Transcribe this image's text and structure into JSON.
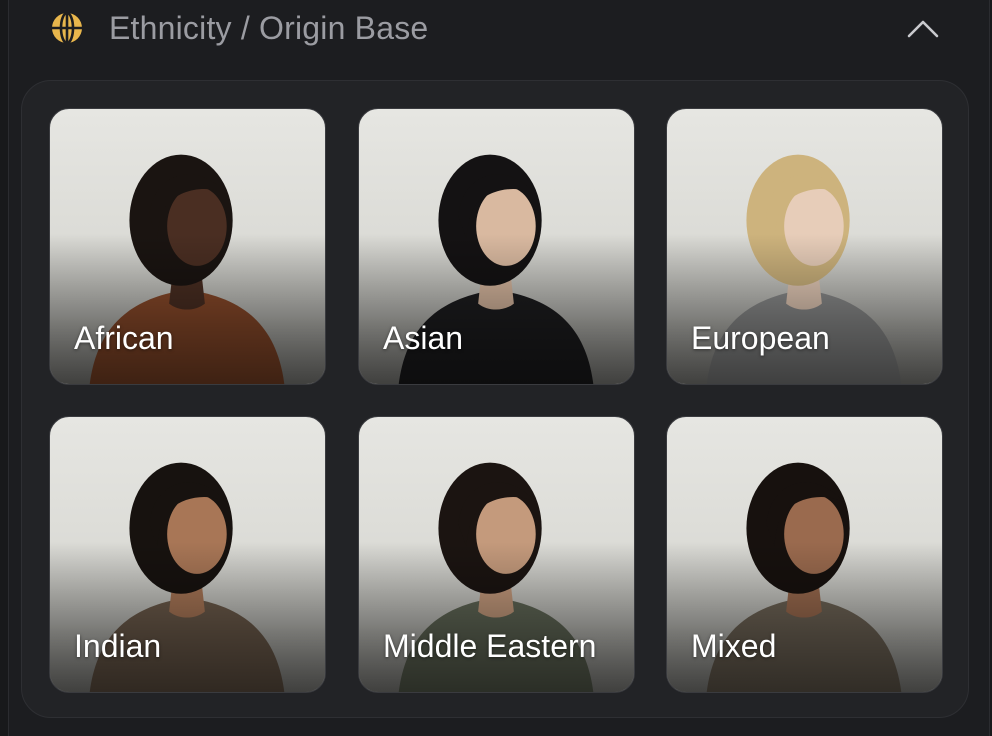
{
  "section": {
    "title": "Ethnicity / Origin Base",
    "icon": "globe-icon",
    "collapse_icon": "chevron-up-icon",
    "accent_color": "#e8b64c"
  },
  "options": [
    {
      "label": "African",
      "hair": "#1a1411",
      "skin": "#4a2e22",
      "top": "#8a4a2a"
    },
    {
      "label": "Asian",
      "hair": "#141213",
      "skin": "#d9b9a0",
      "top": "#1d1d1f"
    },
    {
      "label": "European",
      "hair": "#cdb37d",
      "skin": "#e7cdb9",
      "top": "#8c8d8d"
    },
    {
      "label": "Indian",
      "hair": "#17120f",
      "skin": "#a87656",
      "top": "#6b5a4a"
    },
    {
      "label": "Middle Eastern",
      "hair": "#1b1411",
      "skin": "#c49a7c",
      "top": "#5f6655"
    },
    {
      "label": "Mixed",
      "hair": "#17110e",
      "skin": "#9a6a4e",
      "top": "#6d6355"
    }
  ]
}
